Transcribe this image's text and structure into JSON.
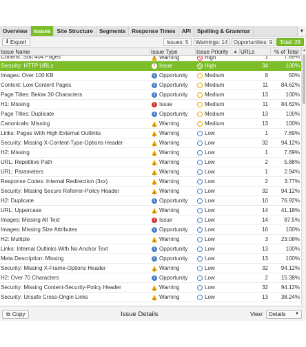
{
  "tabs": [
    {
      "label": "Overview",
      "active": false
    },
    {
      "label": "Issues",
      "active": true
    },
    {
      "label": "Site Structure",
      "active": false
    },
    {
      "label": "Segments",
      "active": false
    },
    {
      "label": "Response Times",
      "active": false
    },
    {
      "label": "API",
      "active": false
    },
    {
      "label": "Spelling & Grammar",
      "active": false
    }
  ],
  "toolbar": {
    "export_label": "Export",
    "issues_count": "Issues: 5",
    "warnings_count": "Warnings: 14",
    "opportunities_count": "Opportunities: 9",
    "total_count": "Total: 28"
  },
  "table": {
    "columns": [
      "Issue Name",
      "Issue Type",
      "Issue Priority",
      "URLs",
      "% of Total"
    ],
    "sorted_column": "Issue Priority",
    "rows": [
      {
        "name": "Content: Soft 404 Pages",
        "type": "Warning",
        "priority": "High",
        "urls": "1",
        "pct": "7.69%"
      },
      {
        "name": "Security: HTTP URLs",
        "type": "Issue",
        "priority": "High",
        "urls": "34",
        "pct": "100%",
        "selected": true
      },
      {
        "name": "Images: Over 100 KB",
        "type": "Opportunity",
        "priority": "Medium",
        "urls": "8",
        "pct": "50%"
      },
      {
        "name": "Content: Low Content Pages",
        "type": "Opportunity",
        "priority": "Medium",
        "urls": "11",
        "pct": "84.62%"
      },
      {
        "name": "Page Titles: Below 30 Characters",
        "type": "Opportunity",
        "priority": "Medium",
        "urls": "13",
        "pct": "100%"
      },
      {
        "name": "H1: Missing",
        "type": "Issue",
        "priority": "Medium",
        "urls": "11",
        "pct": "84.62%"
      },
      {
        "name": "Page Titles: Duplicate",
        "type": "Opportunity",
        "priority": "Medium",
        "urls": "13",
        "pct": "100%"
      },
      {
        "name": "Canonicals: Missing",
        "type": "Warning",
        "priority": "Medium",
        "urls": "13",
        "pct": "100%"
      },
      {
        "name": "Links: Pages With High External Outlinks",
        "type": "Warning",
        "priority": "Low",
        "urls": "1",
        "pct": "7.69%"
      },
      {
        "name": "Security: Missing X-Content-Type-Options Header",
        "type": "Warning",
        "priority": "Low",
        "urls": "32",
        "pct": "94.12%"
      },
      {
        "name": "H2: Missing",
        "type": "Warning",
        "priority": "Low",
        "urls": "1",
        "pct": "7.69%"
      },
      {
        "name": "URL: Repetitive Path",
        "type": "Warning",
        "priority": "Low",
        "urls": "2",
        "pct": "5.88%"
      },
      {
        "name": "URL: Parameters",
        "type": "Warning",
        "priority": "Low",
        "urls": "1",
        "pct": "2.94%"
      },
      {
        "name": "Response Codes: Internal Redirection (3xx)",
        "type": "Warning",
        "priority": "Low",
        "urls": "2",
        "pct": "3.77%"
      },
      {
        "name": "Security: Missing Secure Referrer-Policy Header",
        "type": "Warning",
        "priority": "Low",
        "urls": "32",
        "pct": "94.12%"
      },
      {
        "name": "H2: Duplicate",
        "type": "Opportunity",
        "priority": "Low",
        "urls": "10",
        "pct": "76.92%"
      },
      {
        "name": "URL: Uppercase",
        "type": "Warning",
        "priority": "Low",
        "urls": "14",
        "pct": "41.18%"
      },
      {
        "name": "Images: Missing Alt Text",
        "type": "Issue",
        "priority": "Low",
        "urls": "14",
        "pct": "87.5%"
      },
      {
        "name": "Images: Missing Size Attributes",
        "type": "Opportunity",
        "priority": "Low",
        "urls": "16",
        "pct": "100%"
      },
      {
        "name": "H2: Multiple",
        "type": "Warning",
        "priority": "Low",
        "urls": "3",
        "pct": "23.08%"
      },
      {
        "name": "Links: Internal Outlinks With No Anchor Text",
        "type": "Opportunity",
        "priority": "Low",
        "urls": "13",
        "pct": "100%"
      },
      {
        "name": "Meta Description: Missing",
        "type": "Opportunity",
        "priority": "Low",
        "urls": "13",
        "pct": "100%"
      },
      {
        "name": "Security: Missing X-Frame-Options Header",
        "type": "Warning",
        "priority": "Low",
        "urls": "32",
        "pct": "94.12%"
      },
      {
        "name": "H2: Over 70 Characters",
        "type": "Opportunity",
        "priority": "Low",
        "urls": "2",
        "pct": "15.38%"
      },
      {
        "name": "Security: Missing Content-Security-Policy Header",
        "type": "Warning",
        "priority": "Low",
        "urls": "32",
        "pct": "94.12%"
      },
      {
        "name": "Security: Unsafe Cross-Origin Links",
        "type": "Warning",
        "priority": "Low",
        "urls": "13",
        "pct": "38.24%"
      }
    ]
  },
  "bottom": {
    "copy_label": "Copy",
    "details_title": "Issue Details",
    "view_label": "View:",
    "view_value": "Details"
  },
  "colors": {
    "accent": "#7cbd29",
    "issue": "#d83232",
    "warning": "#f0a800",
    "opportunity": "#4b7fc8"
  }
}
